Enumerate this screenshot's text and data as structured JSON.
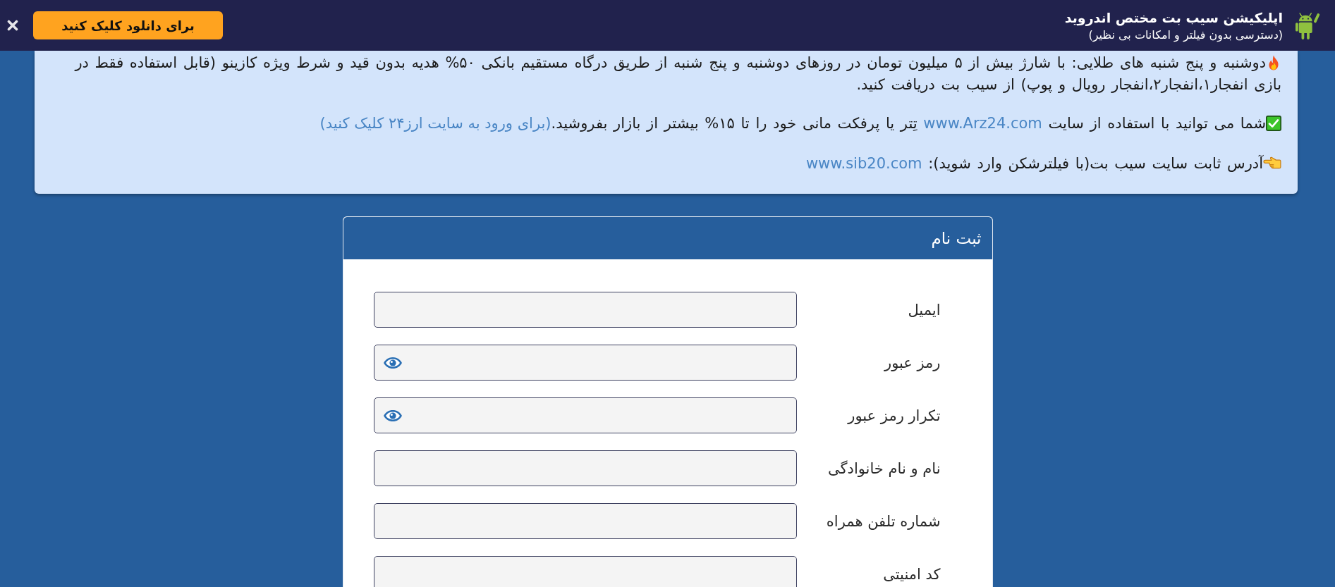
{
  "banner": {
    "button": "برای دانلود کلیک کنید",
    "title": "اپلیکیشن سیب بت مختص اندروید",
    "subtitle": "(دسترسی بدون فیلتر و امکانات بی نظیر)"
  },
  "notice": {
    "paragraphs": [
      {
        "kind": "promo",
        "parts": [
          {
            "kind": "text",
            "text": "دوشنبه و پنج شنبه های طلایی: با شارژ بیش از ۵ میلیون تومان در روزهای دوشنبه و پنج شنبه از طریق درگاه مستقیم بانکی ۵۰% هدیه بدون قید و شرط ویژه کازینو (قابل استفاده فقط در بازی انفجار۱،انفجار۲،انفجار رویال و پوپ) از سیب بت دریافت کنید."
          }
        ]
      },
      {
        "kind": "exchange",
        "parts": [
          {
            "kind": "text",
            "text": "شما می توانید با استفاده از سایت "
          },
          {
            "kind": "link",
            "text": "www.Arz24.com"
          },
          {
            "kind": "text",
            "text": " تِتر یا پرفکت مانی خود را تا ۱۵% بیشتر از بازار بفروشید."
          },
          {
            "kind": "link",
            "text": "(برای ورود به سایت ارز۲۴ کلیک کنید)"
          }
        ]
      },
      {
        "kind": "address",
        "parts": [
          {
            "kind": "text",
            "text": "آدرس ثابت سایت سیب بت(با فیلترشکن وارد شوید): "
          },
          {
            "kind": "link",
            "text": "www.sib20.com"
          }
        ]
      }
    ]
  },
  "form": {
    "title": "ثبت نام",
    "fields": [
      {
        "label": "ایمیل",
        "kind": "text"
      },
      {
        "label": "رمز عبور",
        "kind": "password"
      },
      {
        "label": "تکرار رمز عبور",
        "kind": "password"
      },
      {
        "label": "نام و نام خانوادگی",
        "kind": "text"
      },
      {
        "label": "شماره تلفن همراه",
        "kind": "text"
      },
      {
        "label": "کد امنیتی",
        "kind": "text"
      }
    ]
  }
}
